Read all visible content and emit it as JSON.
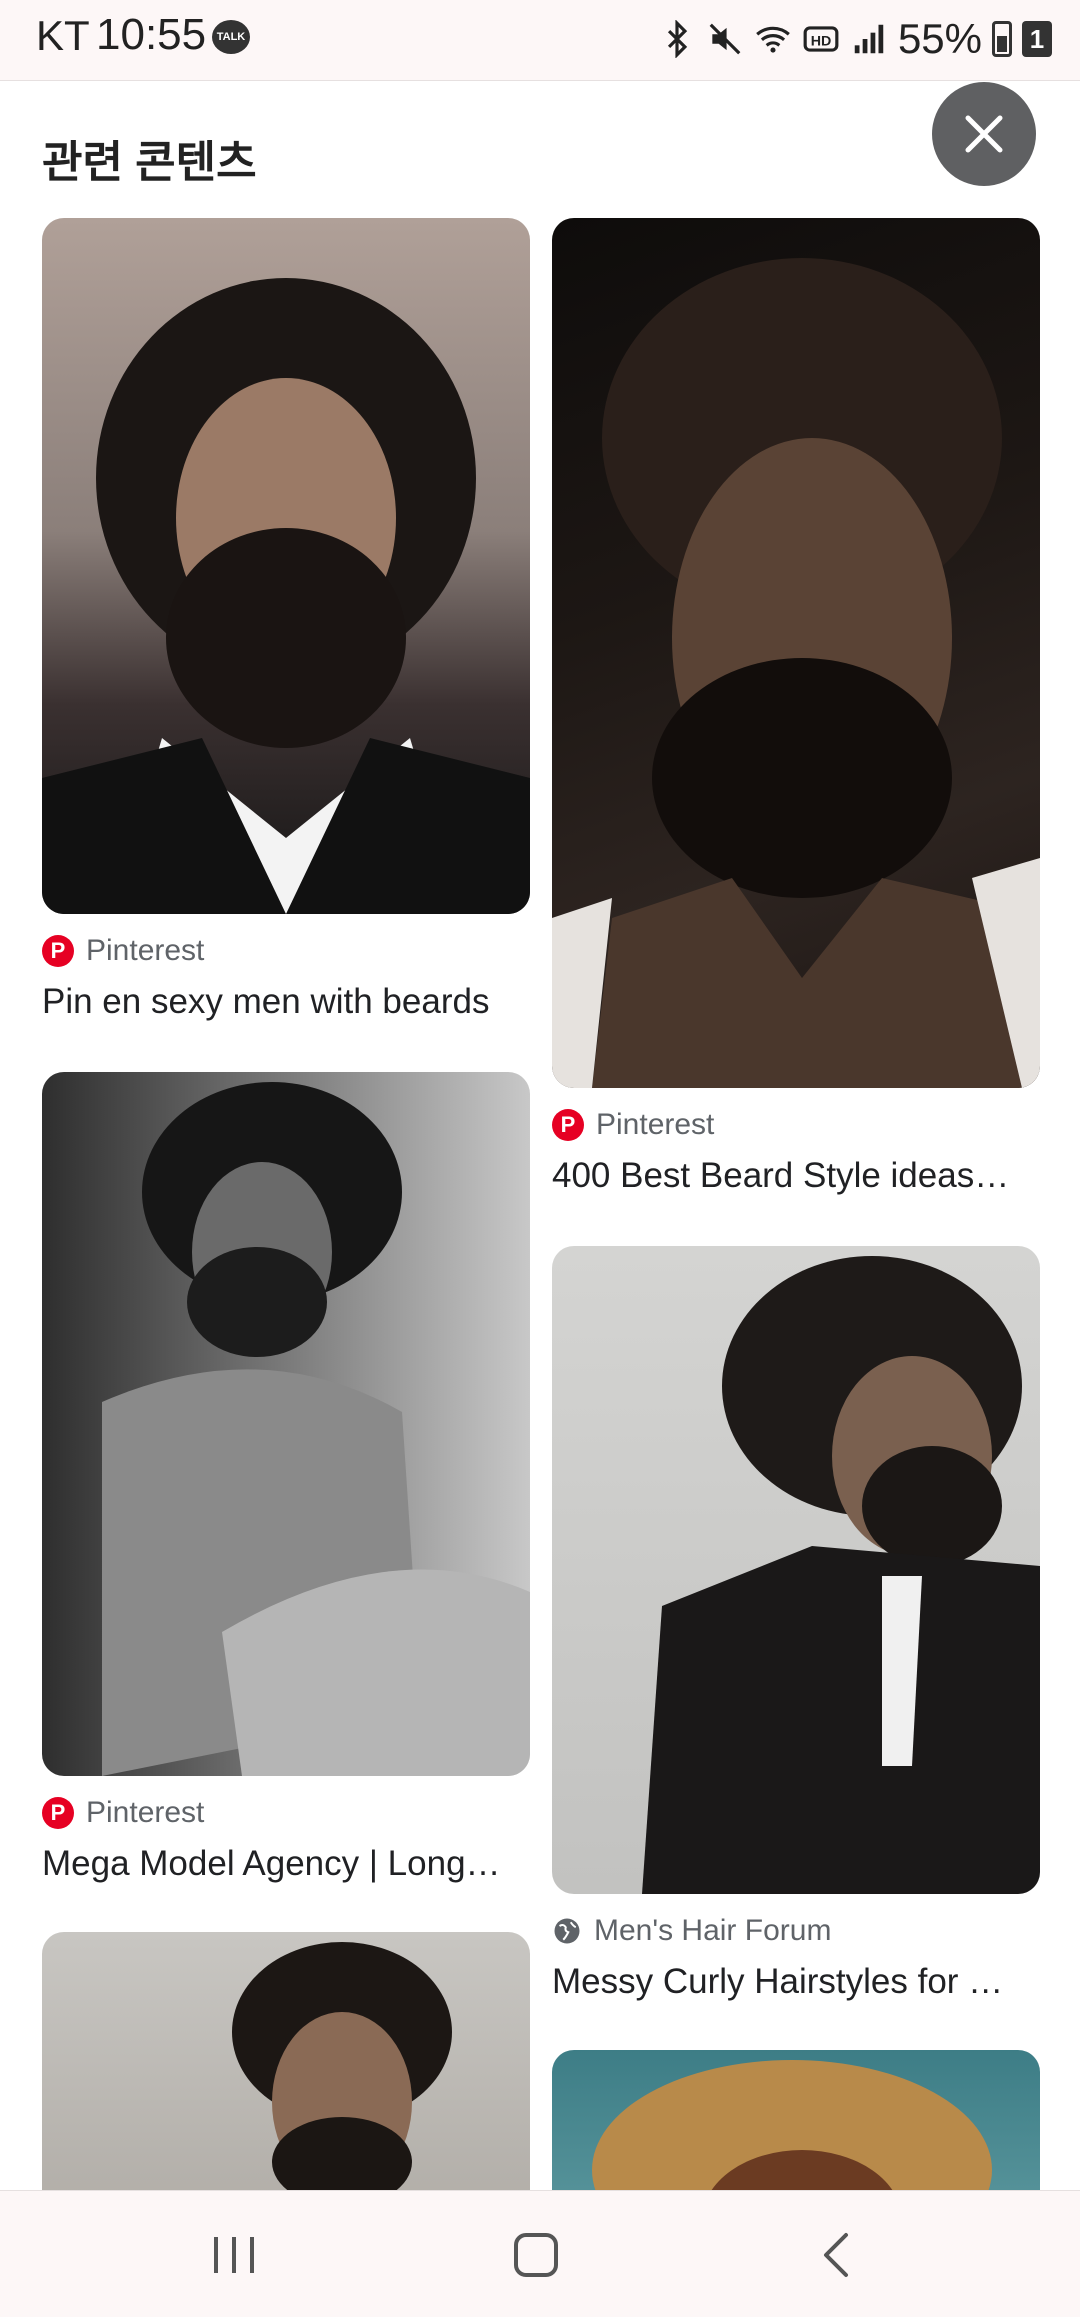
{
  "status_bar": {
    "carrier": "KT",
    "time": "10:55",
    "talk_badge": "TALK",
    "battery": "55%",
    "sim_badge": "1",
    "icons": [
      "bluetooth-icon",
      "mute-icon",
      "wifi-icon",
      "hd-icon",
      "signal-icon",
      "battery-icon"
    ]
  },
  "header": {
    "title": "관련 콘텐츠",
    "close_icon": "close-icon"
  },
  "cards": [
    {
      "source": "Pinterest",
      "caption": "Pin en sexy men with beards",
      "source_icon": "pinterest-icon"
    },
    {
      "source": "Pinterest",
      "caption": "400 Best Beard Style ideas…",
      "source_icon": "pinterest-icon"
    },
    {
      "source": "Pinterest",
      "caption": "Mega Model Agency | Long…",
      "source_icon": "pinterest-icon"
    },
    {
      "source": "Men's Hair Forum",
      "caption": "Messy Curly Hairstyles for …",
      "source_icon": "globe-icon"
    }
  ],
  "nav_bar": {
    "icons": [
      "recent-apps-icon",
      "home-icon",
      "back-icon"
    ]
  },
  "colors": {
    "pinterest_red": "#e60023",
    "close_button_bg": "#5f6062",
    "system_bar_bg": "#fdf7f7"
  }
}
